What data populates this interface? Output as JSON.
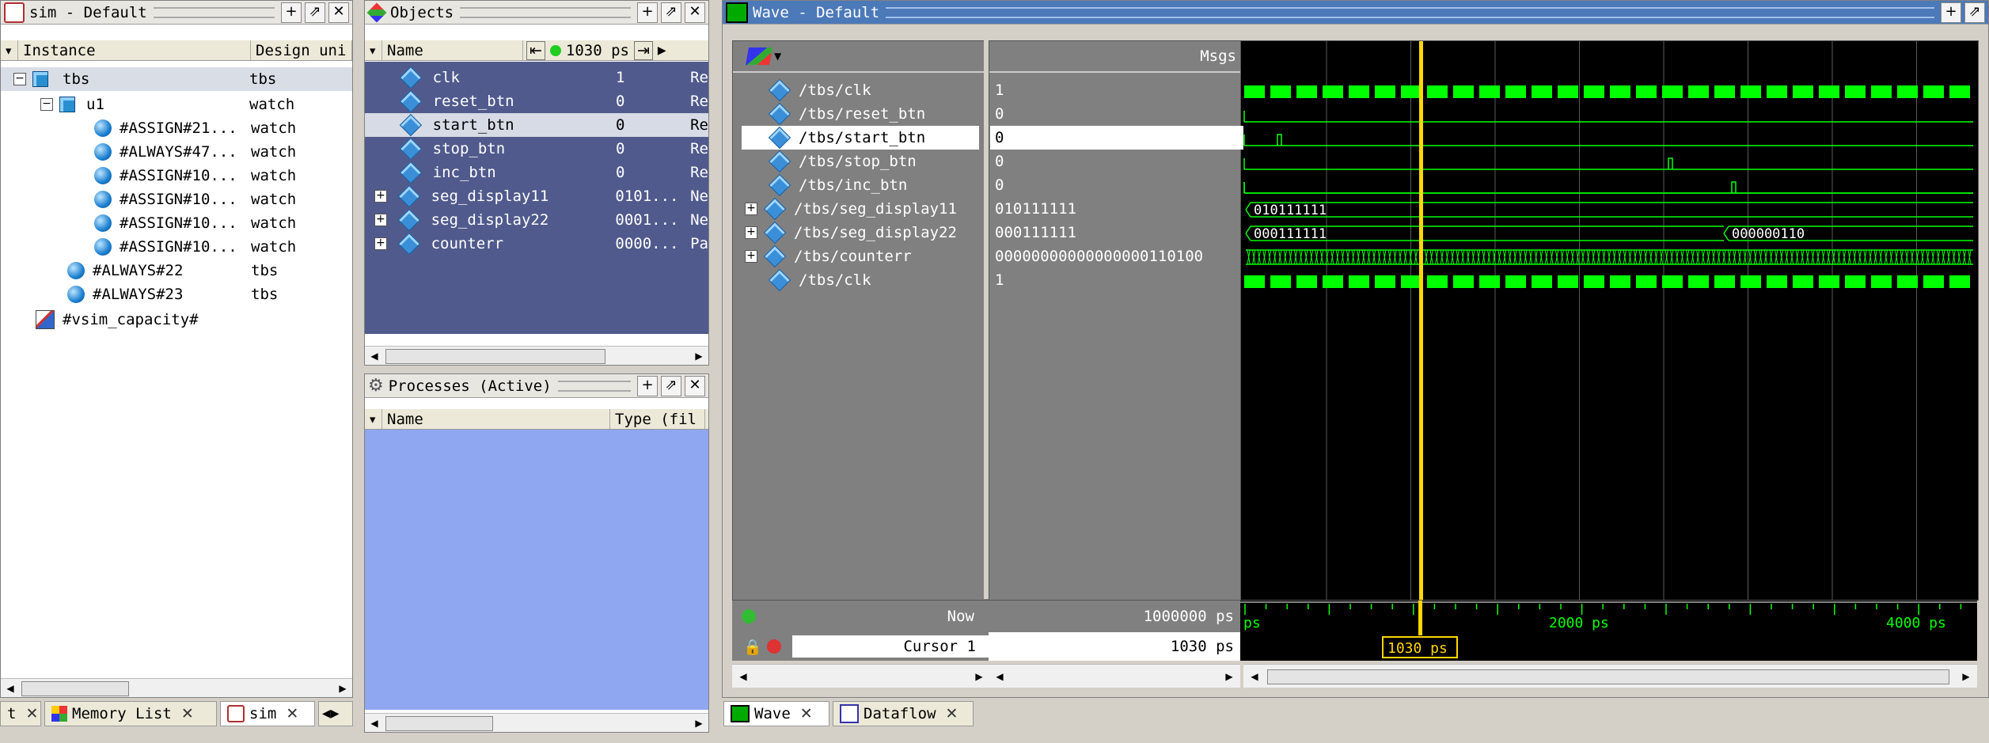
{
  "sim_pane": {
    "title": "sim - Default",
    "columns": [
      "Instance",
      "Design uni"
    ],
    "rows": [
      {
        "name": "tbs",
        "unit": "tbs"
      },
      {
        "name": "u1",
        "unit": "watch"
      },
      {
        "name": "#ASSIGN#21...",
        "unit": "watch"
      },
      {
        "name": "#ALWAYS#47...",
        "unit": "watch"
      },
      {
        "name": "#ASSIGN#10...",
        "unit": "watch"
      },
      {
        "name": "#ASSIGN#10...",
        "unit": "watch"
      },
      {
        "name": "#ASSIGN#10...",
        "unit": "watch"
      },
      {
        "name": "#ASSIGN#10...",
        "unit": "watch"
      },
      {
        "name": "#ALWAYS#22",
        "unit": "tbs"
      },
      {
        "name": "#ALWAYS#23",
        "unit": "tbs"
      },
      {
        "name": "#vsim_capacity#",
        "unit": ""
      }
    ]
  },
  "objects_pane": {
    "title": "Objects",
    "name_col": "Name",
    "time": "1030 ps",
    "rows": [
      {
        "name": "clk",
        "value": "1",
        "kind": "Re"
      },
      {
        "name": "reset_btn",
        "value": "0",
        "kind": "Re"
      },
      {
        "name": "start_btn",
        "value": "0",
        "kind": "Re"
      },
      {
        "name": "stop_btn",
        "value": "0",
        "kind": "Re"
      },
      {
        "name": "inc_btn",
        "value": "0",
        "kind": "Re"
      },
      {
        "name": "seg_display11",
        "value": "0101...",
        "kind": "Ne"
      },
      {
        "name": "seg_display22",
        "value": "0001...",
        "kind": "Ne"
      },
      {
        "name": "counterr",
        "value": "0000...",
        "kind": "Pa"
      }
    ]
  },
  "processes_pane": {
    "title": "Processes (Active)",
    "columns": [
      "Name",
      "Type (fil"
    ]
  },
  "wave_pane": {
    "title": "Wave - Default",
    "msgs_label": "Msgs",
    "signals": [
      {
        "path": "/tbs/clk",
        "value": "1"
      },
      {
        "path": "/tbs/reset_btn",
        "value": "0"
      },
      {
        "path": "/tbs/start_btn",
        "value": "0"
      },
      {
        "path": "/tbs/stop_btn",
        "value": "0"
      },
      {
        "path": "/tbs/inc_btn",
        "value": "0"
      },
      {
        "path": "/tbs/seg_display11",
        "value": "010111111"
      },
      {
        "path": "/tbs/seg_display22",
        "value": "000111111"
      },
      {
        "path": "/tbs/counterr",
        "value": "00000000000000000110100"
      },
      {
        "path": "/tbs/clk",
        "value": "1"
      }
    ],
    "bus_labels": {
      "seg11_a": "010111111",
      "seg22_a": "000111111",
      "seg22_b": "000000110"
    },
    "now_label": "Now",
    "now_value": "1000000 ps",
    "cursor_label": "Cursor 1",
    "cursor_value": "1030 ps",
    "cursor_tag": "1030 ps",
    "ruler": [
      "ps",
      "2000 ps",
      "4000 ps"
    ]
  },
  "bottom_tabs_left": [
    "t",
    "Memory List",
    "sim"
  ],
  "bottom_tabs_wave": [
    "Wave",
    "Dataflow"
  ],
  "colors": {
    "wave_green": "#00ff00",
    "cursor": "#ffd700",
    "objects_bg": "#505a8c",
    "processes_bg": "#8fa6f0"
  }
}
